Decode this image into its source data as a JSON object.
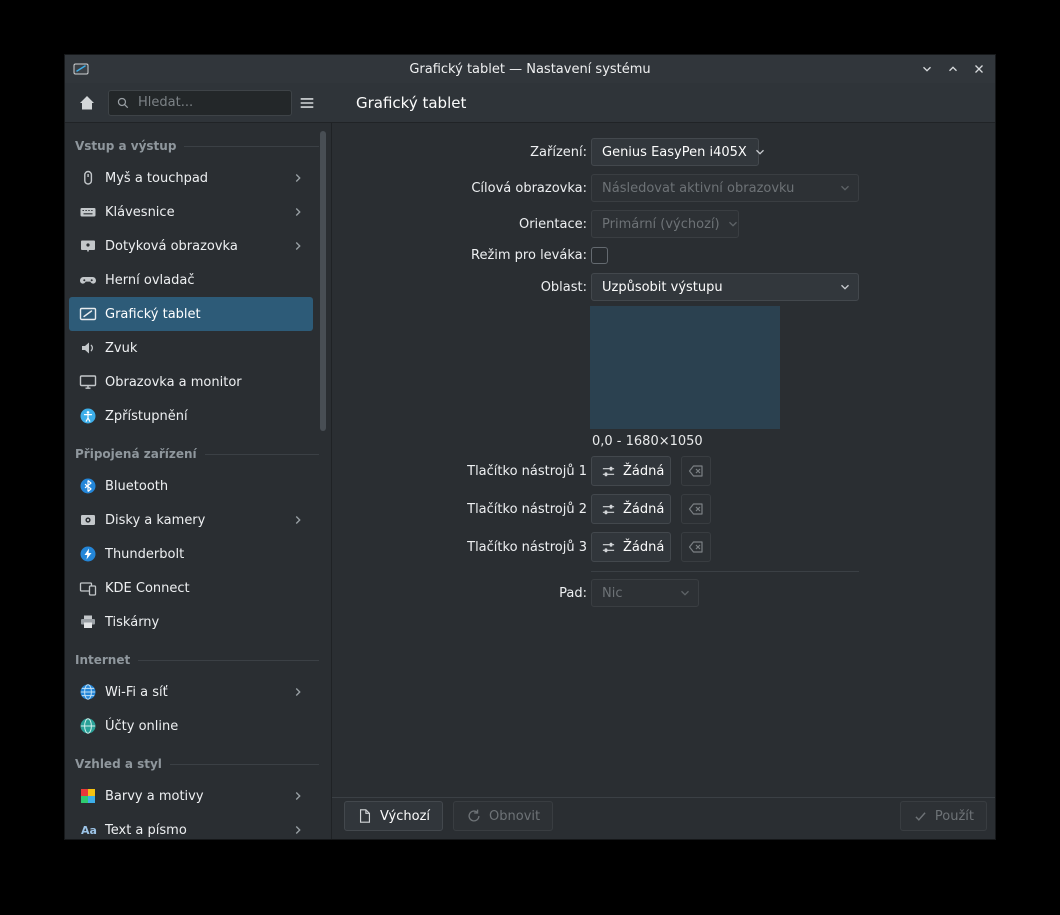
{
  "window": {
    "title": "Grafický tablet — Nastavení systému"
  },
  "header": {
    "search_placeholder": "Hledat...",
    "page_title": "Grafický tablet"
  },
  "sidebar": {
    "sections": [
      {
        "label": "Vstup a výstup",
        "items": [
          {
            "label": "Myš a touchpad",
            "icon": "mouse-icon",
            "chevron": true
          },
          {
            "label": "Klávesnice",
            "icon": "keyboard-icon",
            "chevron": true
          },
          {
            "label": "Dotyková obrazovka",
            "icon": "touchscreen-icon",
            "chevron": true
          },
          {
            "label": "Herní ovladač",
            "icon": "gamepad-icon",
            "chevron": false
          },
          {
            "label": "Grafický tablet",
            "icon": "tablet-icon",
            "chevron": false,
            "selected": true
          },
          {
            "label": "Zvuk",
            "icon": "sound-icon",
            "chevron": false
          },
          {
            "label": "Obrazovka a monitor",
            "icon": "monitor-icon",
            "chevron": false
          },
          {
            "label": "Zpřístupnění",
            "icon": "accessibility-icon",
            "chevron": false
          }
        ]
      },
      {
        "label": "Připojená zařízení",
        "items": [
          {
            "label": "Bluetooth",
            "icon": "bluetooth-icon",
            "chevron": false
          },
          {
            "label": "Disky a kamery",
            "icon": "disks-cameras-icon",
            "chevron": true
          },
          {
            "label": "Thunderbolt",
            "icon": "thunderbolt-icon",
            "chevron": false
          },
          {
            "label": "KDE Connect",
            "icon": "kde-connect-icon",
            "chevron": false
          },
          {
            "label": "Tiskárny",
            "icon": "printer-icon",
            "chevron": false
          }
        ]
      },
      {
        "label": "Internet",
        "items": [
          {
            "label": "Wi-Fi a síť",
            "icon": "wifi-network-icon",
            "chevron": true
          },
          {
            "label": "Účty online",
            "icon": "online-accounts-icon",
            "chevron": false
          }
        ]
      },
      {
        "label": "Vzhled a styl",
        "items": [
          {
            "label": "Barvy a motivy",
            "icon": "colors-themes-icon",
            "chevron": true
          },
          {
            "label": "Text a písmo",
            "icon": "fonts-icon",
            "chevron": true
          }
        ]
      }
    ]
  },
  "form": {
    "device": {
      "label": "Zařízení:",
      "value": "Genius EasyPen i405X",
      "enabled": true
    },
    "target_display": {
      "label": "Cílová obrazovka:",
      "value": "Následovat aktivní obrazovku",
      "enabled": false
    },
    "orientation": {
      "label": "Orientace:",
      "value": "Primární (výchozí)",
      "enabled": false
    },
    "left_handed": {
      "label": "Režim pro leváka:",
      "checked": false
    },
    "area": {
      "label": "Oblast:",
      "value": "Uzpůsobit výstupu",
      "enabled": true,
      "geometry": "0,0 - 1680×1050"
    },
    "tool_buttons": [
      {
        "label": "Tlačítko nástrojů 1",
        "value": "Žádná"
      },
      {
        "label": "Tlačítko nástrojů 2",
        "value": "Žádná"
      },
      {
        "label": "Tlačítko nástrojů 3",
        "value": "Žádná"
      }
    ],
    "pad": {
      "label": "Pad:",
      "value": "Nic",
      "enabled": false
    }
  },
  "footer": {
    "defaults": "Výchozí",
    "reset": "Obnovit",
    "apply": "Použít"
  },
  "colors": {
    "accent": "#3daee9",
    "selection_bg": "#2d5b78",
    "preview_fill": "#2b4150",
    "window_bg": "#2a2e32"
  }
}
